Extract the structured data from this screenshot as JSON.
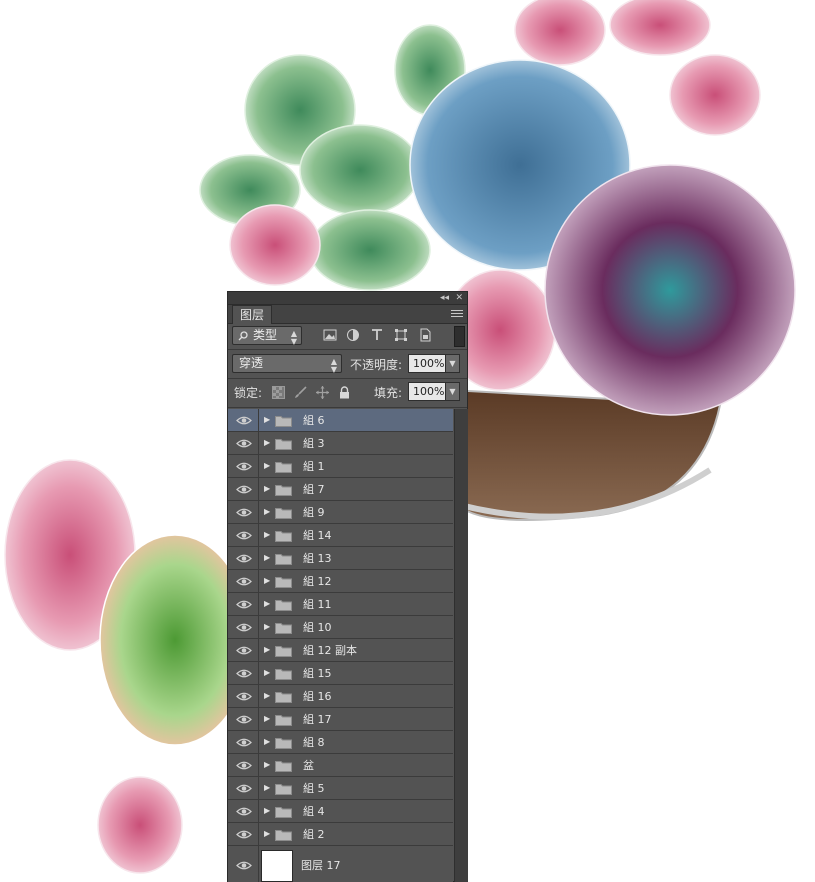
{
  "panel": {
    "tab_label": "图层",
    "collapse_glyph": "◂◂",
    "close_glyph": "✕",
    "filter": {
      "kind_label": "类型"
    },
    "blend_mode": "穿透",
    "opacity_label": "不透明度:",
    "opacity_value": "100%",
    "lock_label": "锁定:",
    "fill_label": "填充:",
    "fill_value": "100%",
    "filter_icons": [
      "image-filter-icon",
      "adjustment-filter-icon",
      "type-filter-icon",
      "shape-filter-icon",
      "smart-object-filter-icon"
    ],
    "lock_icons": [
      "lock-transparent-icon",
      "lock-paint-icon",
      "lock-position-icon",
      "lock-all-icon"
    ]
  },
  "layers": [
    {
      "name": "組 6",
      "type": "group",
      "selected": true
    },
    {
      "name": "組 3",
      "type": "group"
    },
    {
      "name": "組 1",
      "type": "group"
    },
    {
      "name": "組 7",
      "type": "group"
    },
    {
      "name": "組 9",
      "type": "group"
    },
    {
      "name": "組 14",
      "type": "group"
    },
    {
      "name": "組 13",
      "type": "group"
    },
    {
      "name": "組 12",
      "type": "group"
    },
    {
      "name": "組 11",
      "type": "group"
    },
    {
      "name": "組 10",
      "type": "group"
    },
    {
      "name": "組 12 副本",
      "type": "group"
    },
    {
      "name": "組 15",
      "type": "group"
    },
    {
      "name": "組 16",
      "type": "group"
    },
    {
      "name": "組 17",
      "type": "group"
    },
    {
      "name": "組 8",
      "type": "group"
    },
    {
      "name": "盆",
      "type": "group"
    },
    {
      "name": "組 5",
      "type": "group"
    },
    {
      "name": "組 4",
      "type": "group"
    },
    {
      "name": "組 2",
      "type": "group"
    },
    {
      "name": "图层 17",
      "type": "pixel"
    }
  ],
  "colors": {
    "panel_bg": "#535353",
    "selected_row": "#5d6a7f",
    "pot_brown": "#6b4a33",
    "pink": "#d9819a",
    "blue_succulent": "#5f8fb3",
    "purple_succulent": "#7a3563",
    "teal": "#3fa5a0",
    "green": "#7fb07c"
  }
}
